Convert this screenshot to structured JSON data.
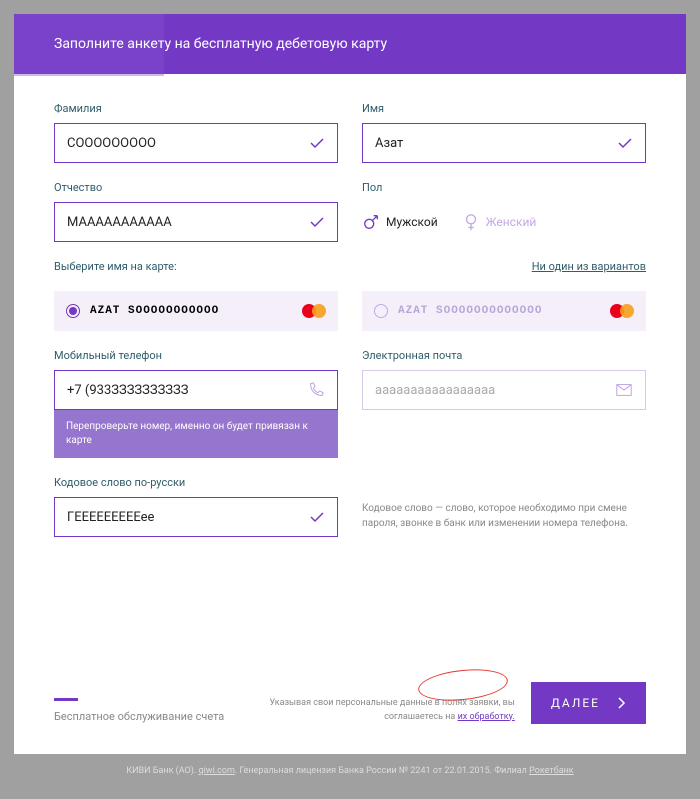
{
  "header": {
    "title": "Заполните анкету на бесплатную дебетовую карту"
  },
  "fields": {
    "surname": {
      "label": "Фамилия",
      "value": "СООООООООО"
    },
    "name": {
      "label": "Имя",
      "value": "Азат"
    },
    "patronymic": {
      "label": "Отчество",
      "value": "МААААААААААА"
    },
    "gender": {
      "label": "Пол",
      "male": "Мужской",
      "female": "Женский"
    },
    "cardname": {
      "label": "Выберите имя на карте:",
      "none_link": "Ни один из вариантов",
      "opt1": "AZAT SOOOOOOOOOOO",
      "opt2": "AZAT SOOOOOOOOOOOOO"
    },
    "phone": {
      "label": "Мобильный телефон",
      "value": "+7 (933ЗЗЗЗЗЗЗЗЗЗ",
      "tooltip": "Перепроверьте номер, именно он будет привязан к карте"
    },
    "email": {
      "label": "Электронная почта",
      "value": "aaaaaaaaaaaaaaaaa"
    },
    "codeword": {
      "label": "Кодовое слово по-русски",
      "value": "ГЕЕЕЕЕЕЕЕЕее",
      "hint": "Кодовое слово — слово, которое необходимо при смене пароля, звонке в банк или изменении номера телефона."
    }
  },
  "footer": {
    "free_label": "Бесплатное обслуживание счета",
    "agree_prefix": "Указывая свои персональные данные в полях заявки, вы соглашаетесь на ",
    "agree_link": "их обработку.",
    "next": "ДАЛЕЕ",
    "legal_prefix": "КИВИ Банк (АО). ",
    "legal_link1": "qiwi.com",
    "legal_mid": ". Генеральная лицензия Банка России № 2241 от 22.01.2015. Филиал ",
    "legal_link2": "Рокетбанк"
  }
}
